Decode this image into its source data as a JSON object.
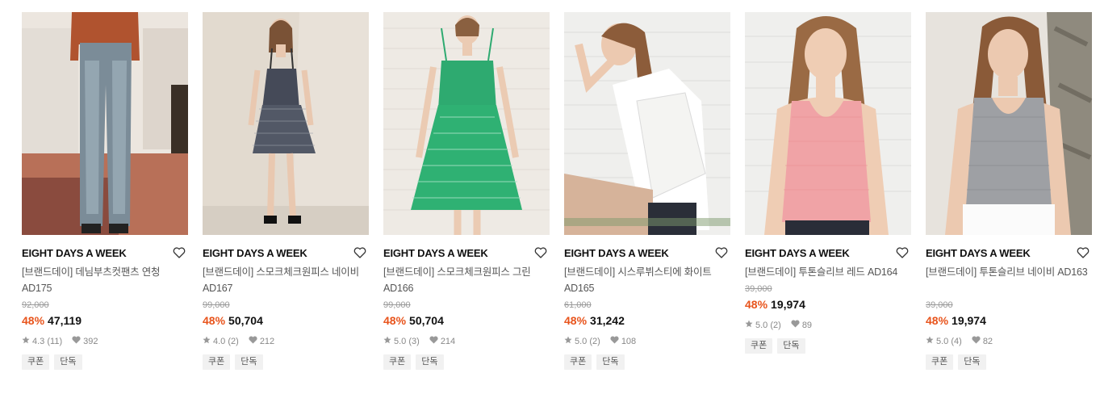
{
  "products": [
    {
      "brand": "EIGHT DAYS A WEEK",
      "name": "[브랜드데이] 데님부츠컷팬츠 연청 AD175",
      "original_price": "92,000",
      "discount": "48%",
      "price": "47,119",
      "rating": "4.3",
      "review_count": "(11)",
      "likes": "392",
      "tags": [
        "쿠폰",
        "단독"
      ],
      "icon": "heart-outline-icon"
    },
    {
      "brand": "EIGHT DAYS A WEEK",
      "name": "[브랜드데이] 스모크체크원피스 네이비 AD167",
      "original_price": "99,000",
      "discount": "48%",
      "price": "50,704",
      "rating": "4.0",
      "review_count": "(2)",
      "likes": "212",
      "tags": [
        "쿠폰",
        "단독"
      ],
      "icon": "heart-outline-icon"
    },
    {
      "brand": "EIGHT DAYS A WEEK",
      "name": "[브랜드데이] 스모크체크원피스 그린 AD166",
      "original_price": "99,000",
      "discount": "48%",
      "price": "50,704",
      "rating": "5.0",
      "review_count": "(3)",
      "likes": "214",
      "tags": [
        "쿠폰",
        "단독"
      ],
      "icon": "heart-outline-icon"
    },
    {
      "brand": "EIGHT DAYS A WEEK",
      "name": "[브랜드데이] 시스루뷔스티에 화이트 AD165",
      "original_price": "61,000",
      "discount": "48%",
      "price": "31,242",
      "rating": "5.0",
      "review_count": "(2)",
      "likes": "108",
      "tags": [
        "쿠폰",
        "단독"
      ],
      "icon": "heart-outline-icon"
    },
    {
      "brand": "EIGHT DAYS A WEEK",
      "name": "[브랜드데이] 투톤슬리브 레드 AD164",
      "original_price": "39,000",
      "discount": "48%",
      "price": "19,974",
      "rating": "5.0",
      "review_count": "(2)",
      "likes": "89",
      "tags": [
        "쿠폰",
        "단독"
      ],
      "icon": "heart-outline-icon"
    },
    {
      "brand": "EIGHT DAYS A WEEK",
      "name": "[브랜드데이] 투톤슬리브 네이비 AD163",
      "original_price": "39,000",
      "discount": "48%",
      "price": "19,974",
      "rating": "5.0",
      "review_count": "(4)",
      "likes": "82",
      "tags": [
        "쿠폰",
        "단독"
      ],
      "icon": "heart-outline-icon"
    }
  ],
  "colors": {
    "discount": "#e8541c",
    "brand": "#111111",
    "muted": "#888888",
    "tag_bg": "#f1f1f1"
  }
}
